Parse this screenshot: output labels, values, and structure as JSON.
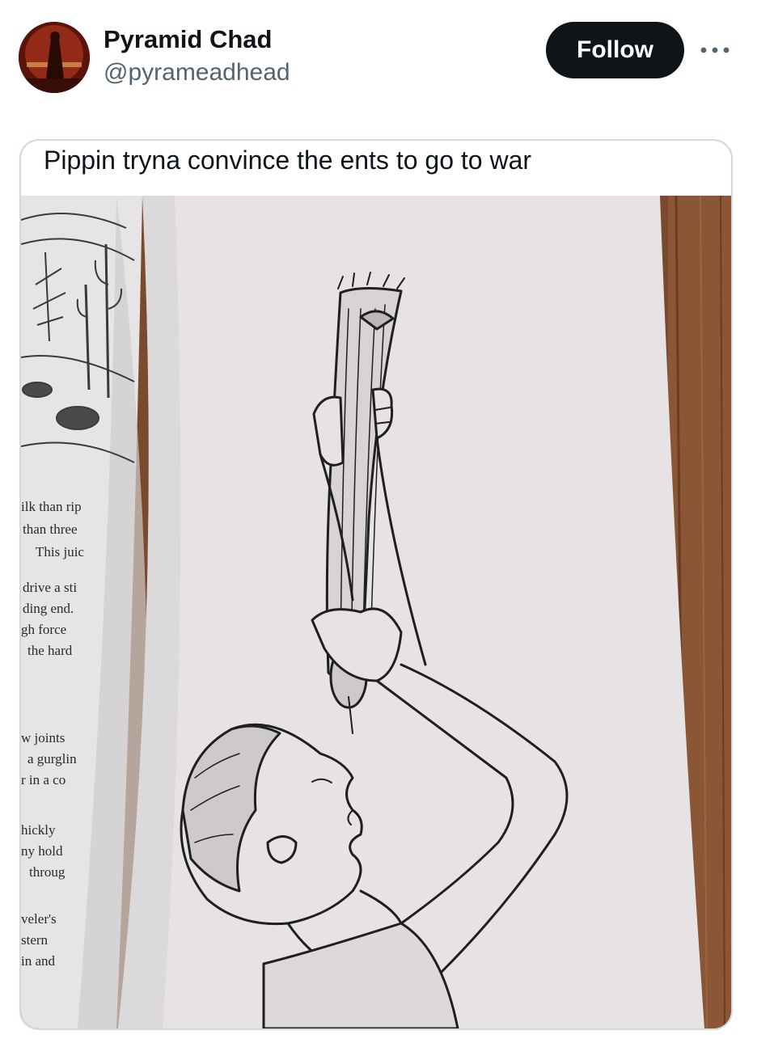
{
  "author": {
    "display_name": "Pyramid Chad",
    "handle": "@pyrameadhead"
  },
  "actions": {
    "follow_label": "Follow",
    "more_icon": "more-horizontal-icon"
  },
  "post": {
    "text": "Pippin tryna convince the ents to go to war"
  },
  "book_left_page_lines": [
    "ilk than rip",
    "than three",
    "This juic",
    "drive a sti",
    "ding end.",
    "gh force",
    "the hard",
    "w joints",
    "a gurglin",
    "r in a co",
    "hickly",
    "ny hold",
    "throug",
    "veler's",
    "stern",
    "in and"
  ],
  "colors": {
    "follow_bg": "#0f1419",
    "handle_gray": "#536471",
    "card_border": "#cfd9de"
  }
}
